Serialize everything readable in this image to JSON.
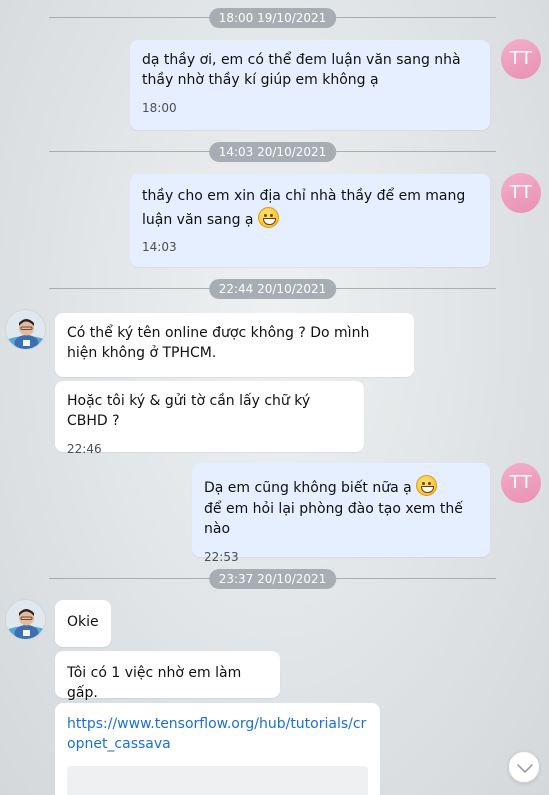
{
  "dividers": [
    "18:00 19/10/2021",
    "14:03 20/10/2021",
    "22:44 20/10/2021",
    "23:37 20/10/2021"
  ],
  "sender_avatar_initials": "TT",
  "messages": [
    {
      "text": "dạ thầy ơi, em có thể đem luận văn sang nhà thầy nhờ thầy kí giúp em không ạ",
      "time": "18:00"
    },
    {
      "text": "thầy cho em xin địa chỉ nhà thầy để em mang luận văn sang ạ",
      "time": "14:03"
    },
    {
      "text": "Có thể ký tên online được không ? Do mình hiện không ở TPHCM."
    },
    {
      "text": "Hoặc tôi ký & gửi tờ cần lấy chữ ký CBHD ?",
      "time": "22:46"
    },
    {
      "text_line1": "Dạ em cũng không biết nữa ạ",
      "text_line2": "để em hỏi lại phòng đào tạo xem thế nào",
      "time": "22:53"
    },
    {
      "text": "Okie"
    },
    {
      "text": "Tôi có 1 việc nhờ em làm gấp."
    },
    {
      "link": "https://www.tensorflow.org/hub/tutorials/cropnet_cassava"
    }
  ],
  "icons": {
    "emoji": "grinning-face-emoji",
    "scroll": "chevron-down-icon",
    "avatar": "user-photo-avatar"
  },
  "colors": {
    "my_bubble": "#e5efff",
    "their_bubble": "#ffffff",
    "link": "#1a6fd6",
    "tt_avatar": "#ec9dbd"
  }
}
